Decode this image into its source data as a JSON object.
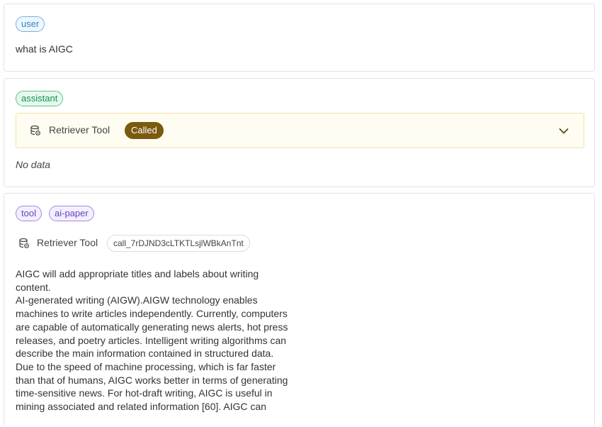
{
  "messages": [
    {
      "role_tag": "user",
      "text": "what is AIGC"
    },
    {
      "role_tag": "assistant",
      "tool_name": "Retriever Tool",
      "status": "Called",
      "output": "No data"
    },
    {
      "tags": [
        "tool",
        "ai-paper"
      ],
      "tool_name": "Retriever Tool",
      "call_id": "call_7rDJND3cLTKTLsjlWBkAnTnt",
      "content": "AIGC will add appropriate titles and labels about writing\ncontent.\nAI-generated writing (AIGW).AIGW technology enables\nmachines to write articles independently. Currently, computers\nare capable of automatically generating news alerts, hot press\nreleases, and poetry articles. Intelligent writing algorithms can\ndescribe the main information contained in structured data.\nDue to the speed of machine processing, which is far faster\nthan that of humans, AIGC works better in terms of generating\ntime-sensitive news. For hot-draft writing, AIGC is useful in\nmining associated and related information [60]. AIGC can"
    }
  ],
  "icons": {
    "tool": "database-icon",
    "expand": "chevron-down-icon"
  },
  "colors": {
    "user": "#2a86c6",
    "assistant": "#16924f",
    "tool": "#6a44c2",
    "called_badge": "#7a5a0f"
  }
}
